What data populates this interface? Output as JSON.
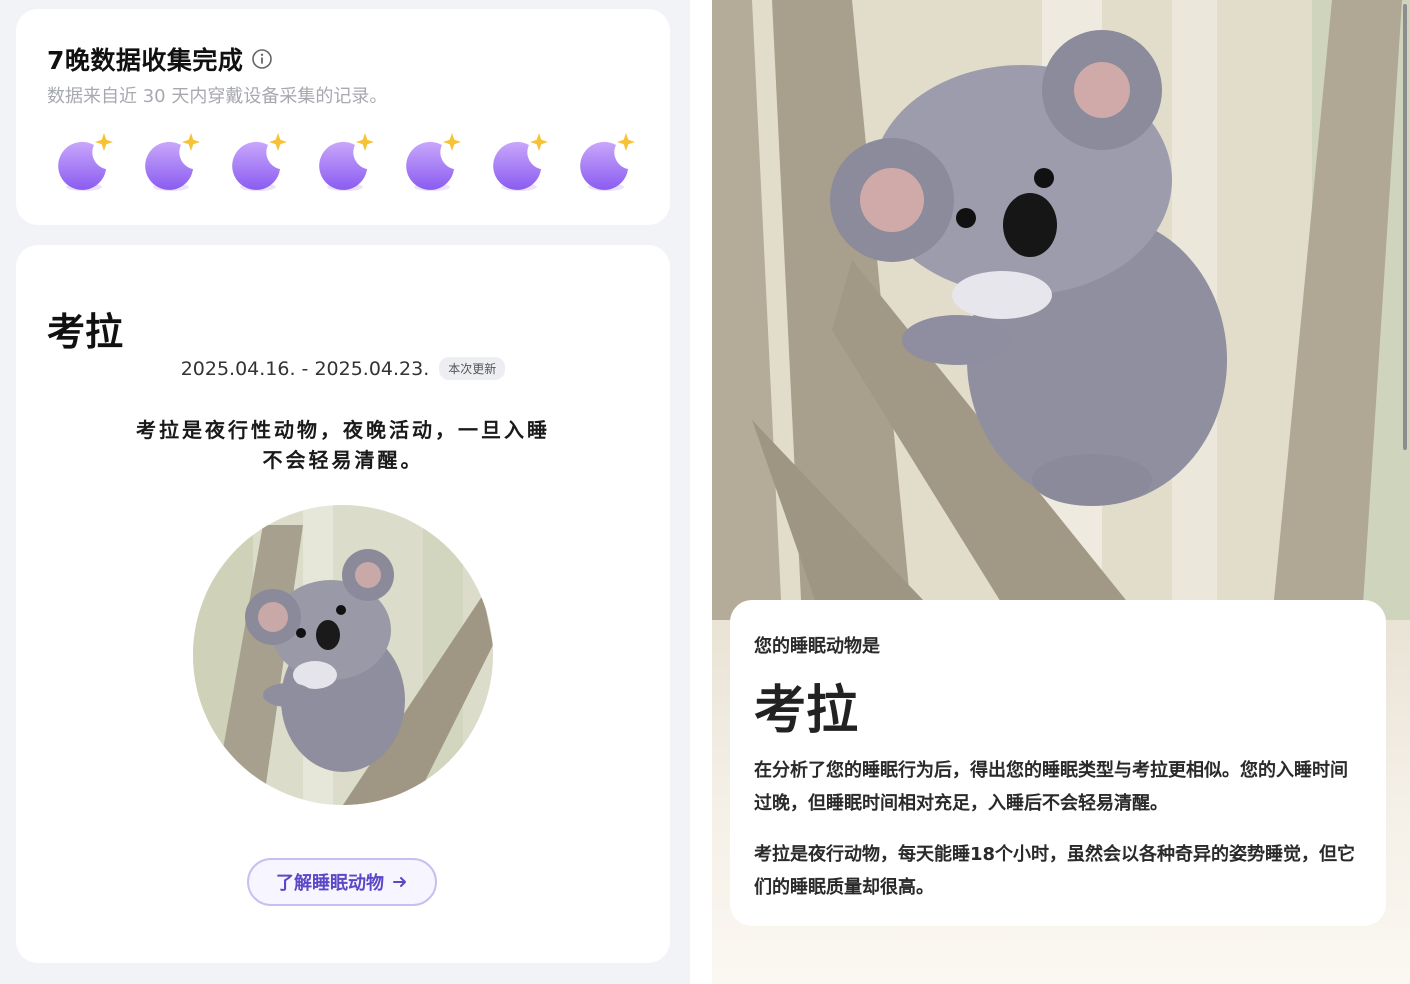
{
  "summary_card": {
    "title": "7晚数据收集完成",
    "subtitle": "数据来自近 30 天内穿戴设备采集的记录。",
    "info_icon": "info-circle-icon",
    "nights": [
      "moon-star-icon",
      "moon-star-icon",
      "moon-star-icon",
      "moon-star-icon",
      "moon-star-icon",
      "moon-star-icon",
      "moon-star-icon"
    ]
  },
  "animal_card": {
    "name": "考拉",
    "date_range": "2025.04.16. - 2025.04.23.",
    "update_badge": "本次更新",
    "description": "考拉是夜行性动物，夜晚活动，一旦入睡不会轻易清醒。",
    "button_label": "了解睡眠动物",
    "button_icon": "arrow-right-icon"
  },
  "detail": {
    "label": "您的睡眠动物是",
    "name": "考拉",
    "paragraph1": "在分析了您的睡眠行为后，得出您的睡眠类型与考拉更相似。您的入睡时间过晚，但睡眠时间相对充足，入睡后不会轻易清醒。",
    "paragraph2": "考拉是夜行动物，每天能睡18个小时，虽然会以各种奇异的姿势睡觉，但它们的睡眠质量却很高。"
  },
  "colors": {
    "accent": "#5a48c6",
    "moon": "#a77df0",
    "star": "#f7c236",
    "panel_bg": "#f1f3f7"
  }
}
